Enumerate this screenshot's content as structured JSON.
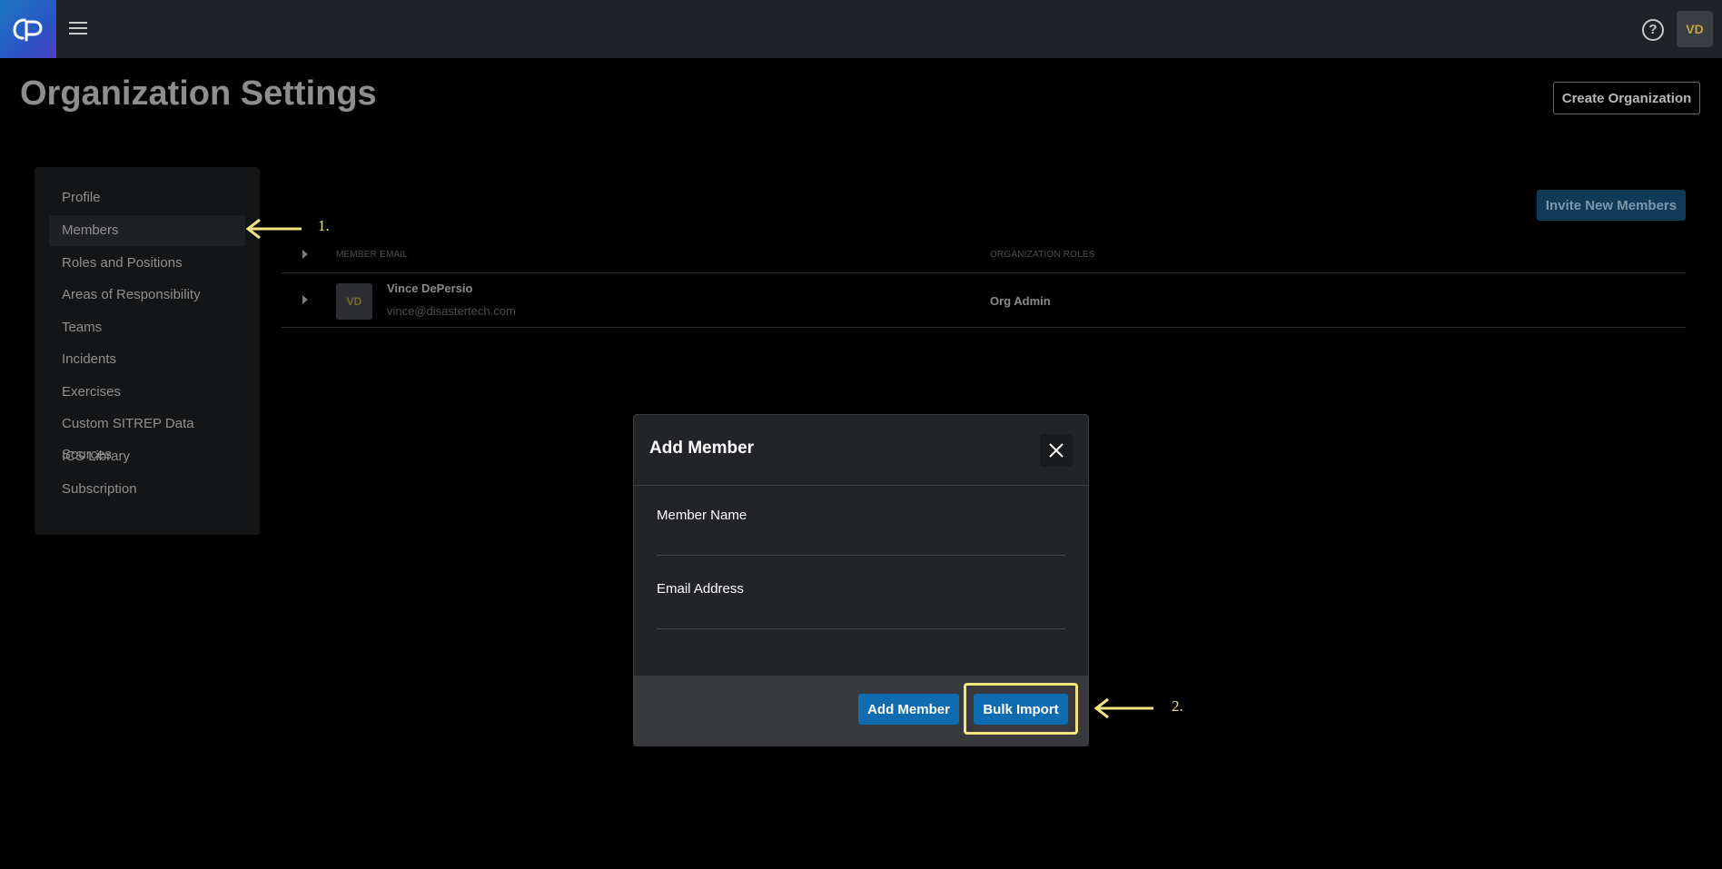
{
  "header": {
    "logo_icon": "cp-logo-icon",
    "menu_icon": "hamburger-menu-icon",
    "help_icon": "help-circle-icon",
    "help_glyph": "?",
    "user_initials": "VD"
  },
  "page": {
    "title": "Organization Settings",
    "create_org_label": "Create Organization"
  },
  "sidebar": {
    "items": [
      {
        "label": "Profile"
      },
      {
        "label": "Members",
        "active": true
      },
      {
        "label": "Roles and Positions"
      },
      {
        "label": "Areas of Responsibility"
      },
      {
        "label": "Teams"
      },
      {
        "label": "Incidents"
      },
      {
        "label": "Exercises"
      },
      {
        "label": "Custom SITREP Data Sources"
      },
      {
        "label": "ICS Library"
      },
      {
        "label": "Subscription"
      }
    ]
  },
  "members": {
    "invite_label": "Invite New Members",
    "columns": [
      "MEMBER EMAIL",
      "ORGANIZATION ROLES"
    ],
    "rows": [
      {
        "initials": "VD",
        "name": "Vince DePersio",
        "email": "vince@disastertech.com",
        "role": "Org Admin"
      }
    ]
  },
  "modal": {
    "title": "Add Member",
    "close_icon": "close-icon",
    "name_label": "Member Name",
    "name_value": "",
    "email_label": "Email Address",
    "email_value": "",
    "add_label": "Add Member",
    "bulk_label": "Bulk Import"
  },
  "annotations": {
    "step1": "1.",
    "step2": "2.",
    "color": "#f3e57d"
  }
}
